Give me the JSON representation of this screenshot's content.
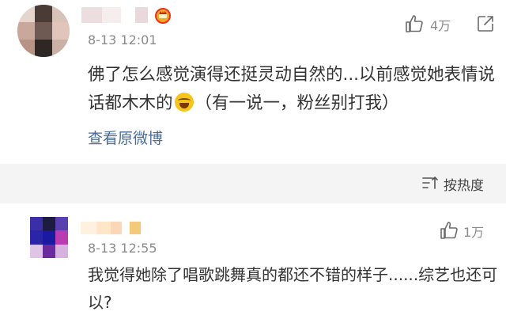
{
  "comments": [
    {
      "time": "8-13 12:01",
      "likes": "4万",
      "text_a": "佛了怎么感觉演得还挺灵动自然的...以前感觉她表情说话都木木的",
      "text_b": "（有一说一，粉丝别打我）",
      "view_original": "查看原微博"
    },
    {
      "time": "8-13 12:55",
      "likes": "1万",
      "text": "我觉得她除了唱歌跳舞真的都还不错的样子......综艺也还可以?"
    }
  ],
  "sort": {
    "label": "按热度"
  },
  "colors": {
    "link": "#4a6c9b",
    "meta": "#8a8a8a",
    "band": "#f4f4f4"
  },
  "icons": {
    "like": "thumbs-up-icon",
    "more": "share-icon",
    "sort": "sort-icon",
    "emoji": "laughing-tears-emoji"
  }
}
